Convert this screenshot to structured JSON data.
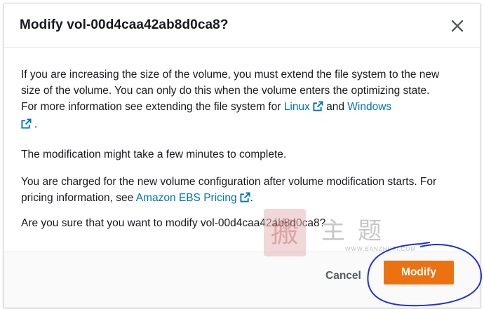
{
  "dialog": {
    "title": "Modify vol-00d4caa42ab8d0ca8?",
    "close_icon": "close-icon"
  },
  "body": {
    "p1_text": "If you are increasing the size of the volume, you must extend the file system to the new size of the volume. You can only do this when the volume enters the optimizing state. For more information see extending the file system for ",
    "p1_link_linux": "Linux",
    "p1_and": " and ",
    "p1_link_windows": "Windows",
    "p1_end": ".",
    "p2_text": "The modification might take a few minutes to complete.",
    "p3_text": "You are charged for the new volume configuration after volume modification starts. For pricing information, see ",
    "p3_link": "Amazon EBS Pricing",
    "p3_end": ".",
    "p4_text": "Are you sure that you want to modify vol-00d4caa42ab8d0ca8?",
    "external_link_icon": "external-link-icon"
  },
  "footer": {
    "cancel_label": "Cancel",
    "modify_label": "Modify"
  },
  "watermark": {
    "seal_char": "搬",
    "text": "主题",
    "sub": "WWW.BANZHUTI.COM"
  },
  "colors": {
    "primary": "#ec7211",
    "link": "#0073bb",
    "annotation": "#1f2fd6"
  }
}
